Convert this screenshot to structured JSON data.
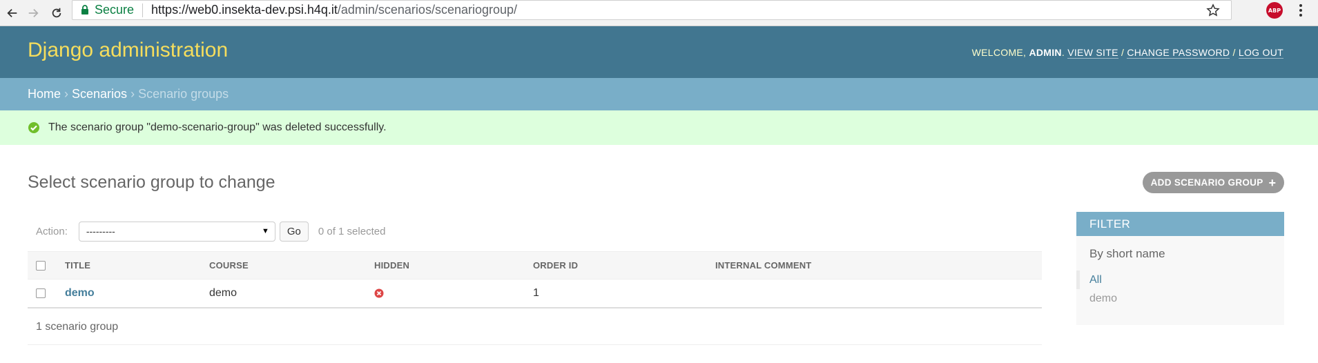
{
  "browser": {
    "secure_label": "Secure",
    "url_host": "https://web0.insekta-dev.psi.h4q.it",
    "url_path": "/admin/scenarios/scenariogroup/",
    "extension_label": "ABP"
  },
  "header": {
    "branding": "Django administration",
    "welcome": "WELCOME,",
    "username": "ADMIN",
    "view_site": "VIEW SITE",
    "change_password": "CHANGE PASSWORD",
    "log_out": "LOG OUT",
    "separator": "/"
  },
  "breadcrumbs": {
    "home": "Home",
    "scenarios": "Scenarios",
    "current": "Scenario groups",
    "arrow": "›"
  },
  "message": {
    "text": "The scenario group \"demo-scenario-group\" was deleted successfully."
  },
  "content": {
    "title": "Select scenario group to change",
    "add_button": "ADD SCENARIO GROUP",
    "add_icon": "plus-icon"
  },
  "actions": {
    "label": "Action:",
    "selected_option": "---------",
    "go_label": "Go",
    "counter": "0 of 1 selected"
  },
  "table": {
    "columns": [
      "TITLE",
      "COURSE",
      "HIDDEN",
      "ORDER ID",
      "INTERNAL COMMENT"
    ],
    "rows": [
      {
        "title": "demo",
        "course": "demo",
        "hidden": "no-icon",
        "order_id": "1",
        "internal_comment": ""
      }
    ]
  },
  "paginator": {
    "text": "1 scenario group"
  },
  "filter": {
    "title": "FILTER",
    "subtitle": "By short name",
    "items": [
      "All",
      "demo"
    ],
    "selected_index": 0
  },
  "colors": {
    "header_bg": "#417690",
    "breadcrumb_bg": "#79aec8",
    "branding": "#f5dd5d",
    "success_bg": "#ddffdd",
    "link": "#447e9b"
  }
}
